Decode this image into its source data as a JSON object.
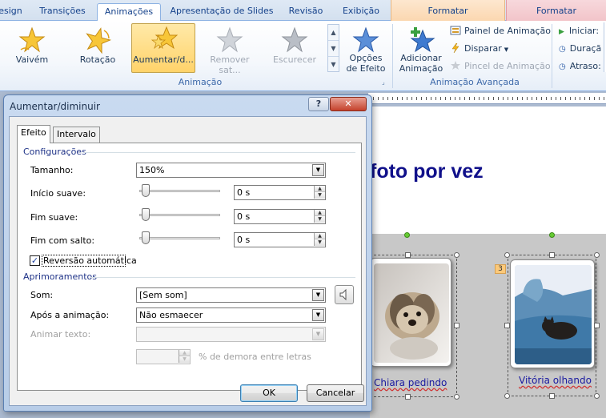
{
  "ribbon": {
    "tabs": [
      {
        "label": "esign"
      },
      {
        "label": "Transições"
      },
      {
        "label": "Animações"
      },
      {
        "label": "Apresentação de Slides"
      },
      {
        "label": "Revisão"
      },
      {
        "label": "Exibição"
      },
      {
        "label": "Formatar"
      },
      {
        "label": "Formatar"
      }
    ],
    "gallery": [
      {
        "label": "Vaivém",
        "icon": "star-gold-icon"
      },
      {
        "label": "Rotação",
        "icon": "star-rotate-icon"
      },
      {
        "label": "Aumentar/d...",
        "icon": "star-grow-icon"
      },
      {
        "label": "Remover sat...",
        "icon": "star-gray-icon"
      },
      {
        "label": "Escurecer",
        "icon": "star-dark-icon"
      }
    ],
    "effect_options": {
      "line1": "Opções",
      "line2": "de Efeito"
    },
    "group_animation_label": "Animação",
    "add_animation": {
      "line1": "Adicionar",
      "line2": "Animação"
    },
    "animation_pane": "Painel de Animação",
    "trigger": "Disparar",
    "painter": "Pincel de Animação",
    "group_advanced_label": "Animação Avançada",
    "start_label": "Iniciar:",
    "duration_label": "Duraçã",
    "delay_label": "Atraso:"
  },
  "slide": {
    "title": "foto por vez",
    "captions": [
      "Chiara pedindo",
      "Vitória olhando"
    ],
    "sequence_tag": "3"
  },
  "dialog": {
    "title": "Aumentar/diminuir",
    "help": "?",
    "close": "✕",
    "tabs": [
      "Efeito",
      "Intervalo"
    ],
    "settings_section": "Configurações",
    "size_label": "Tamanho:",
    "size_value": "150%",
    "smooth_start_label": "Início suave:",
    "smooth_start_value": "0 s",
    "smooth_end_label": "Fim suave:",
    "smooth_end_value": "0 s",
    "bounce_end_label": "Fim com salto:",
    "bounce_end_value": "0 s",
    "auto_reverse_label": "Reversão automática",
    "auto_reverse_checked": true,
    "enhancements_section": "Aprimoramentos",
    "sound_label": "Som:",
    "sound_value": "[Sem som]",
    "after_anim_label": "Após a animação:",
    "after_anim_value": "Não esmaecer",
    "animate_text_label": "Animar texto:",
    "animate_text_value": "",
    "delay_letters_label": "% de demora entre letras",
    "ok": "OK",
    "cancel": "Cancelar"
  }
}
